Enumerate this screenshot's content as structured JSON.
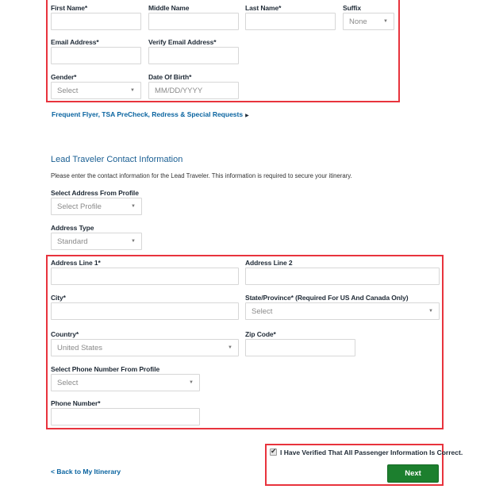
{
  "passenger": {
    "first_name": {
      "label": "First Name*",
      "value": ""
    },
    "middle_name": {
      "label": "Middle Name",
      "value": ""
    },
    "last_name": {
      "label": "Last Name*",
      "value": ""
    },
    "suffix": {
      "label": "Suffix",
      "selected": "None"
    },
    "email": {
      "label": "Email Address*",
      "value": ""
    },
    "verify_email": {
      "label": "Verify Email Address*",
      "value": ""
    },
    "gender": {
      "label": "Gender*",
      "selected": "Select"
    },
    "dob": {
      "label": "Date Of Birth*",
      "placeholder": "MM/DD/YYYY"
    }
  },
  "frequent_flyer_link": {
    "label": "Frequent Flyer, TSA PreCheck, Redress & Special Requests",
    "icon": "caret-right-icon"
  },
  "contact": {
    "title": "Lead Traveler Contact Information",
    "description": "Please enter the contact information for the Lead Traveler. This information is required to secure your itinerary.",
    "address_profile": {
      "label": "Select Address From Profile",
      "selected": "Select Profile"
    },
    "address_type": {
      "label": "Address Type",
      "selected": "Standard"
    },
    "address_line1": {
      "label": "Address Line 1*",
      "value": ""
    },
    "address_line2": {
      "label": "Address Line 2",
      "value": ""
    },
    "city": {
      "label": "City*",
      "value": ""
    },
    "state": {
      "label": "State/Province* (Required For US And Canada Only)",
      "selected": "Select"
    },
    "country": {
      "label": "Country*",
      "selected": "United States"
    },
    "zip": {
      "label": "Zip Code*",
      "value": ""
    },
    "phone_profile": {
      "label": "Select Phone Number From Profile",
      "selected": "Select"
    },
    "phone": {
      "label": "Phone Number*",
      "value": ""
    }
  },
  "footer": {
    "verify_checkbox": {
      "label": "I Have Verified That All Passenger Information Is Correct.",
      "checked": true
    },
    "back_link": "< Back to My Itinerary",
    "next_button": "Next"
  },
  "colors": {
    "highlight_border": "#e8333d",
    "link": "#0a64a0",
    "heading": "#1a5f93",
    "primary_button": "#1c7f2e"
  }
}
